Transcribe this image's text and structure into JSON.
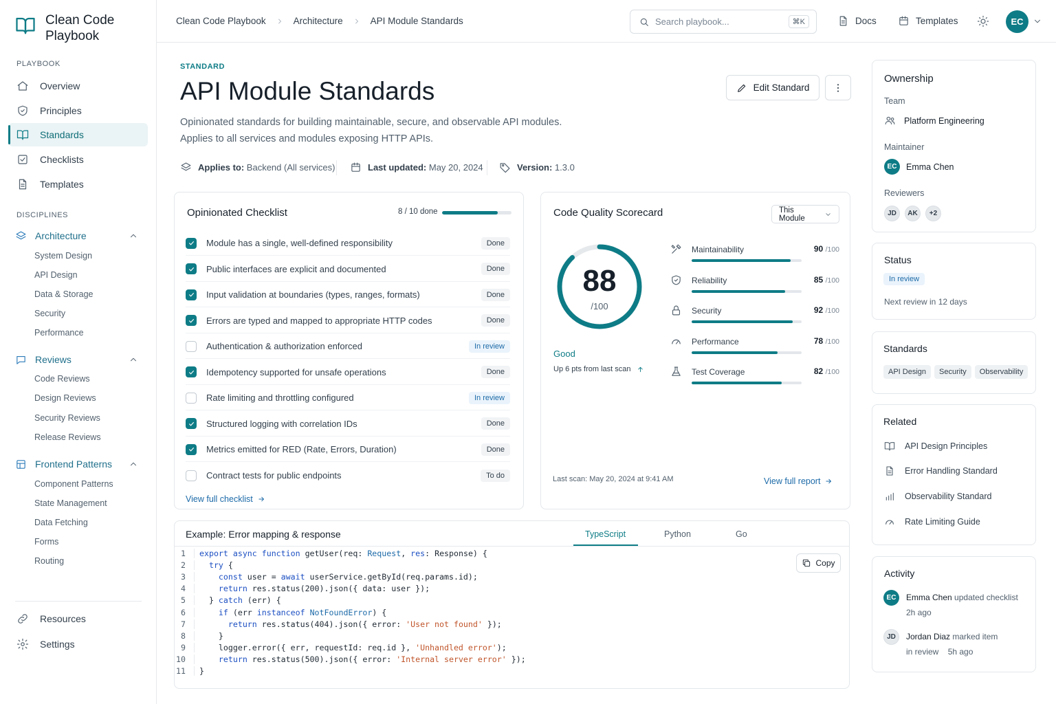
{
  "brand": {
    "name": "Clean Code Playbook"
  },
  "sidebar": {
    "section_playbook": "PLAYBOOK",
    "items": [
      {
        "label": "Overview",
        "icon": "home-icon"
      },
      {
        "label": "Principles",
        "icon": "shield-icon"
      },
      {
        "label": "Standards",
        "icon": "book-icon"
      },
      {
        "label": "Checklists",
        "icon": "checkbox-icon"
      },
      {
        "label": "Templates",
        "icon": "document-icon"
      }
    ],
    "section_disciplines": "DISCIPLINES",
    "disciplines": [
      {
        "label": "Architecture",
        "icon": "layers-icon",
        "children": [
          "System Design",
          "API Design",
          "Data & Storage",
          "Security",
          "Performance"
        ]
      },
      {
        "label": "Reviews",
        "icon": "chat-icon",
        "children": [
          "Code Reviews",
          "Design Reviews",
          "Security Reviews",
          "Release Reviews"
        ]
      },
      {
        "label": "Frontend Patterns",
        "icon": "grid-icon",
        "children": [
          "Component Patterns",
          "State Management",
          "Data Fetching",
          "Forms",
          "Routing"
        ]
      }
    ],
    "footer": [
      {
        "label": "Resources",
        "icon": "link-icon"
      },
      {
        "label": "Settings",
        "icon": "gear-icon"
      }
    ]
  },
  "header": {
    "breadcrumbs": [
      "Clean Code Playbook",
      "Architecture",
      "API Module Standards"
    ],
    "search_placeholder": "Search playbook...",
    "search_shortcut": "⌘K",
    "links": [
      {
        "label": "Docs",
        "icon": "document-icon"
      },
      {
        "label": "Templates",
        "icon": "calendar-icon"
      }
    ],
    "avatar_initials": "EC"
  },
  "page": {
    "eyebrow": "STANDARD",
    "title": "API Module Standards",
    "description_line1": "Opinionated standards for building maintainable, secure, and observable API modules.",
    "description_line2": "Applies to all services and modules exposing HTTP APIs.",
    "applies_label": "Applies to:",
    "applies_value": "Backend (All services)",
    "updated_label": "Last updated:",
    "updated_value": "May 20, 2024",
    "version_label": "Version:",
    "version_value": "1.3.0",
    "edit_button": "Edit Standard"
  },
  "checklist": {
    "title": "Opinionated Checklist",
    "progress_text": "8 / 10 done",
    "progress_fraction": 0.8,
    "items": [
      {
        "text": "Module has a single, well-defined responsibility",
        "checked": true,
        "status": "Done"
      },
      {
        "text": "Public interfaces are explicit and documented",
        "checked": true,
        "status": "Done"
      },
      {
        "text": "Input validation at boundaries (types, ranges, formats)",
        "checked": true,
        "status": "Done"
      },
      {
        "text": "Errors are typed and mapped to appropriate HTTP codes",
        "checked": true,
        "status": "Done"
      },
      {
        "text": "Authentication & authorization enforced",
        "checked": false,
        "status": "In review"
      },
      {
        "text": "Idempotency supported for unsafe operations",
        "checked": true,
        "status": "Done"
      },
      {
        "text": "Rate limiting and throttling configured",
        "checked": false,
        "status": "In review"
      },
      {
        "text": "Structured logging with correlation IDs",
        "checked": true,
        "status": "Done"
      },
      {
        "text": "Metrics emitted for RED (Rate, Errors, Duration)",
        "checked": true,
        "status": "Done"
      },
      {
        "text": "Contract tests for public endpoints",
        "checked": false,
        "status": "To do"
      }
    ],
    "view_link": "View full checklist"
  },
  "scorecard": {
    "title": "Code Quality Scorecard",
    "scope": "This Module",
    "score": "88",
    "score_max": "/100",
    "score_value": 88,
    "grade": "Good",
    "delta": "Up 6 pts from last scan",
    "metrics": [
      {
        "name": "Maintainability",
        "value": 90,
        "icon": "tools-icon"
      },
      {
        "name": "Reliability",
        "value": 85,
        "icon": "shield-icon"
      },
      {
        "name": "Security",
        "value": 92,
        "icon": "lock-icon"
      },
      {
        "name": "Performance",
        "value": 78,
        "icon": "gauge-icon"
      },
      {
        "name": "Test Coverage",
        "value": 82,
        "icon": "flask-icon"
      }
    ],
    "metric_max": "/100",
    "last_scan": "Last scan: May 20, 2024 at 9:41 AM",
    "view_link": "View full report"
  },
  "example": {
    "title": "Example: Error mapping & response",
    "tabs": [
      "TypeScript",
      "Python",
      "Go"
    ],
    "active_tab": "TypeScript",
    "copy_label": "Copy"
  },
  "ownership": {
    "title": "Ownership",
    "team_label": "Team",
    "team": "Platform Engineering",
    "maintainer_label": "Maintainer",
    "maintainer_initials": "EC",
    "maintainer": "Emma Chen",
    "reviewers_label": "Reviewers",
    "reviewers": [
      "JD",
      "AK",
      "+2"
    ]
  },
  "status": {
    "title": "Status",
    "badge": "In review",
    "next_review": "Next review in 12 days"
  },
  "standards": {
    "title": "Standards",
    "tags": [
      "API Design",
      "Security",
      "Observability"
    ]
  },
  "related": {
    "title": "Related",
    "items": [
      {
        "label": "API Design Principles",
        "icon": "book-icon"
      },
      {
        "label": "Error Handling Standard",
        "icon": "document-icon"
      },
      {
        "label": "Observability Standard",
        "icon": "bar-chart-icon"
      },
      {
        "label": "Rate Limiting Guide",
        "icon": "gauge-icon"
      }
    ]
  },
  "activity": {
    "title": "Activity",
    "items": [
      {
        "initials": "EC",
        "name": "Emma Chen",
        "action": "updated checklist",
        "detail": "",
        "time": "2h ago"
      },
      {
        "initials": "JD",
        "name": "Jordan Diaz",
        "action": "marked item",
        "detail": "in review",
        "time": "5h ago"
      }
    ]
  },
  "colors": {
    "accent": "#0e7c86",
    "link": "#1c6aa8",
    "review": "#1c6aa8"
  }
}
